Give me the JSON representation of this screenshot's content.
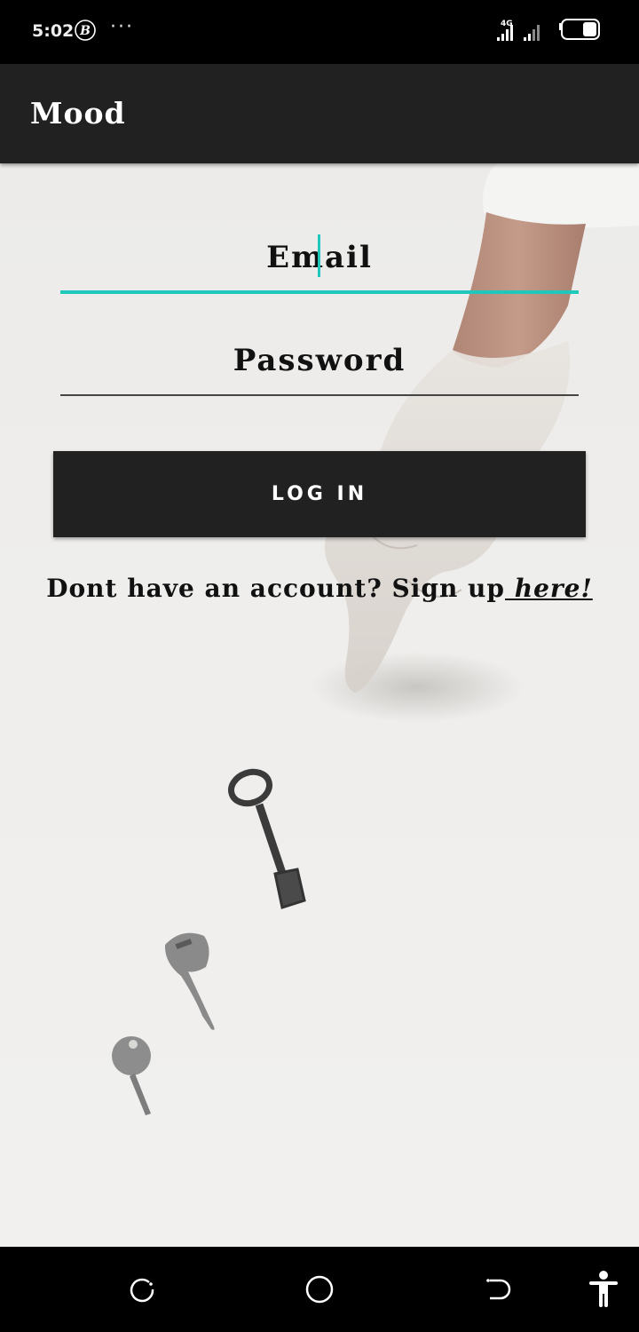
{
  "status_bar": {
    "time": "5:02",
    "b_icon": "B",
    "dots": "···",
    "network": "4G"
  },
  "app_bar": {
    "title": "Mood"
  },
  "form": {
    "email_placeholder": "Email",
    "password_placeholder": "Password",
    "login_label": "LOG IN",
    "signup_prefix": "Dont have an account? Sign up",
    "signup_link": " here!"
  },
  "colors": {
    "accent": "#20c8bb",
    "bar": "#212121"
  },
  "icons": {
    "nav_recents": "recents-icon",
    "nav_home": "home-icon",
    "nav_back": "back-icon",
    "accessibility": "accessibility-icon"
  }
}
